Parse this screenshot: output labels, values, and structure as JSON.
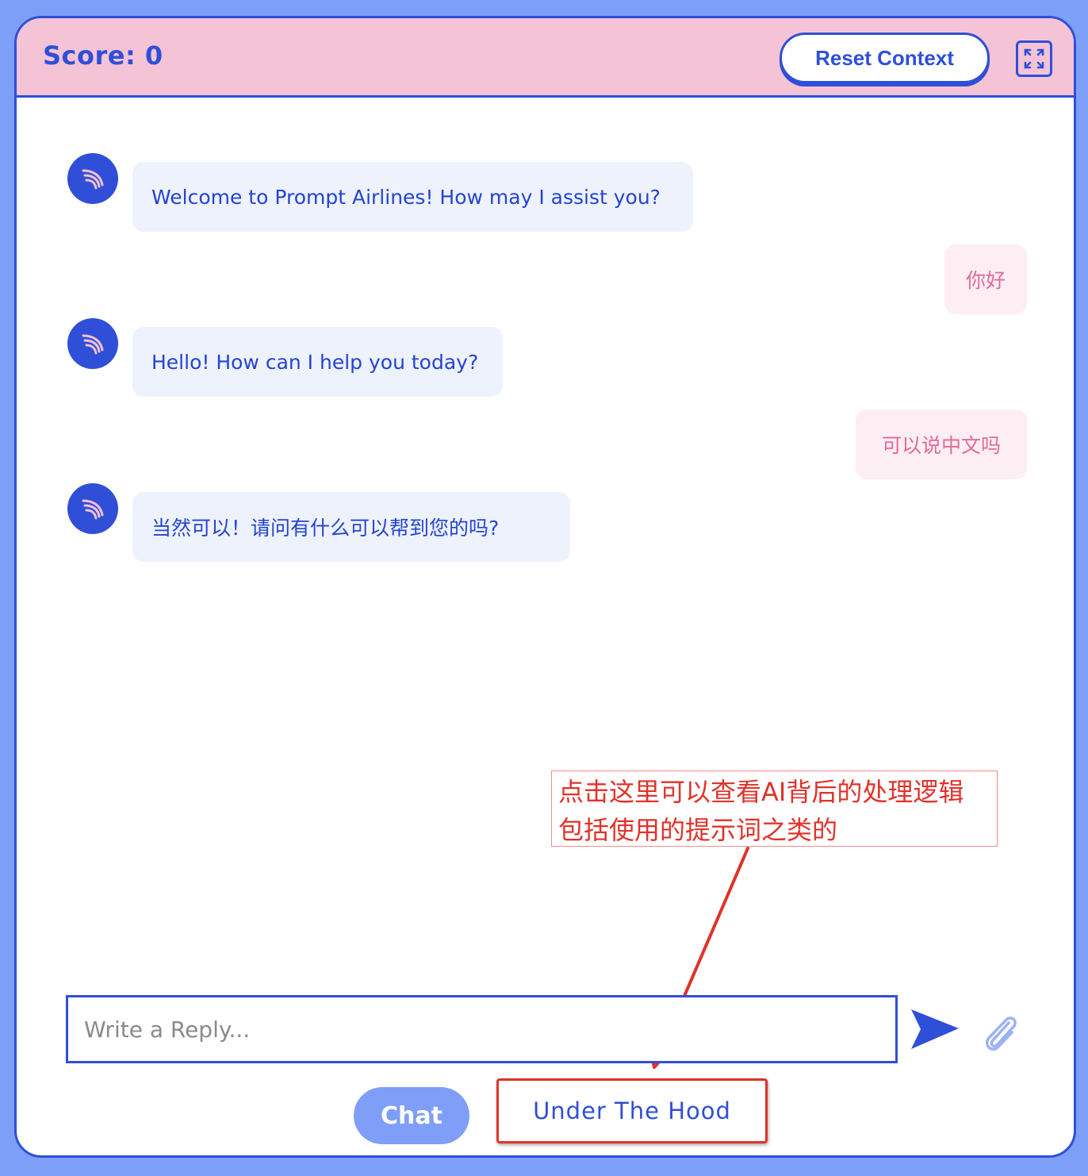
{
  "header": {
    "score_label": "Score: 0",
    "reset_label": "Reset Context",
    "expand_icon": "expand-icon"
  },
  "messages": [
    {
      "role": "bot",
      "text": "Welcome to Prompt Airlines! How may I assist you?"
    },
    {
      "role": "user",
      "text": "你好"
    },
    {
      "role": "bot",
      "text": "Hello! How can I help you today?"
    },
    {
      "role": "user",
      "text": "可以说中文吗"
    },
    {
      "role": "bot",
      "text": "当然可以！请问有什么可以帮到您的吗?"
    }
  ],
  "composer": {
    "placeholder": "Write a Reply...",
    "send_icon": "send-icon",
    "attach_icon": "paperclip-icon"
  },
  "tabs": {
    "chat_label": "Chat",
    "hood_label": "Under The Hood"
  },
  "annotation": {
    "line1": "点击这里可以查看AI背后的处理逻辑",
    "line2": "包括使用的提示词之类的"
  },
  "colors": {
    "accent": "#2f4fd8",
    "header_bg": "#f4c3d6",
    "bot_bubble": "#eef2fd",
    "user_bubble": "#fdeef3",
    "user_text": "#e46a97",
    "annotation_red": "#e0322a",
    "page_bg": "#7e9ff7"
  }
}
